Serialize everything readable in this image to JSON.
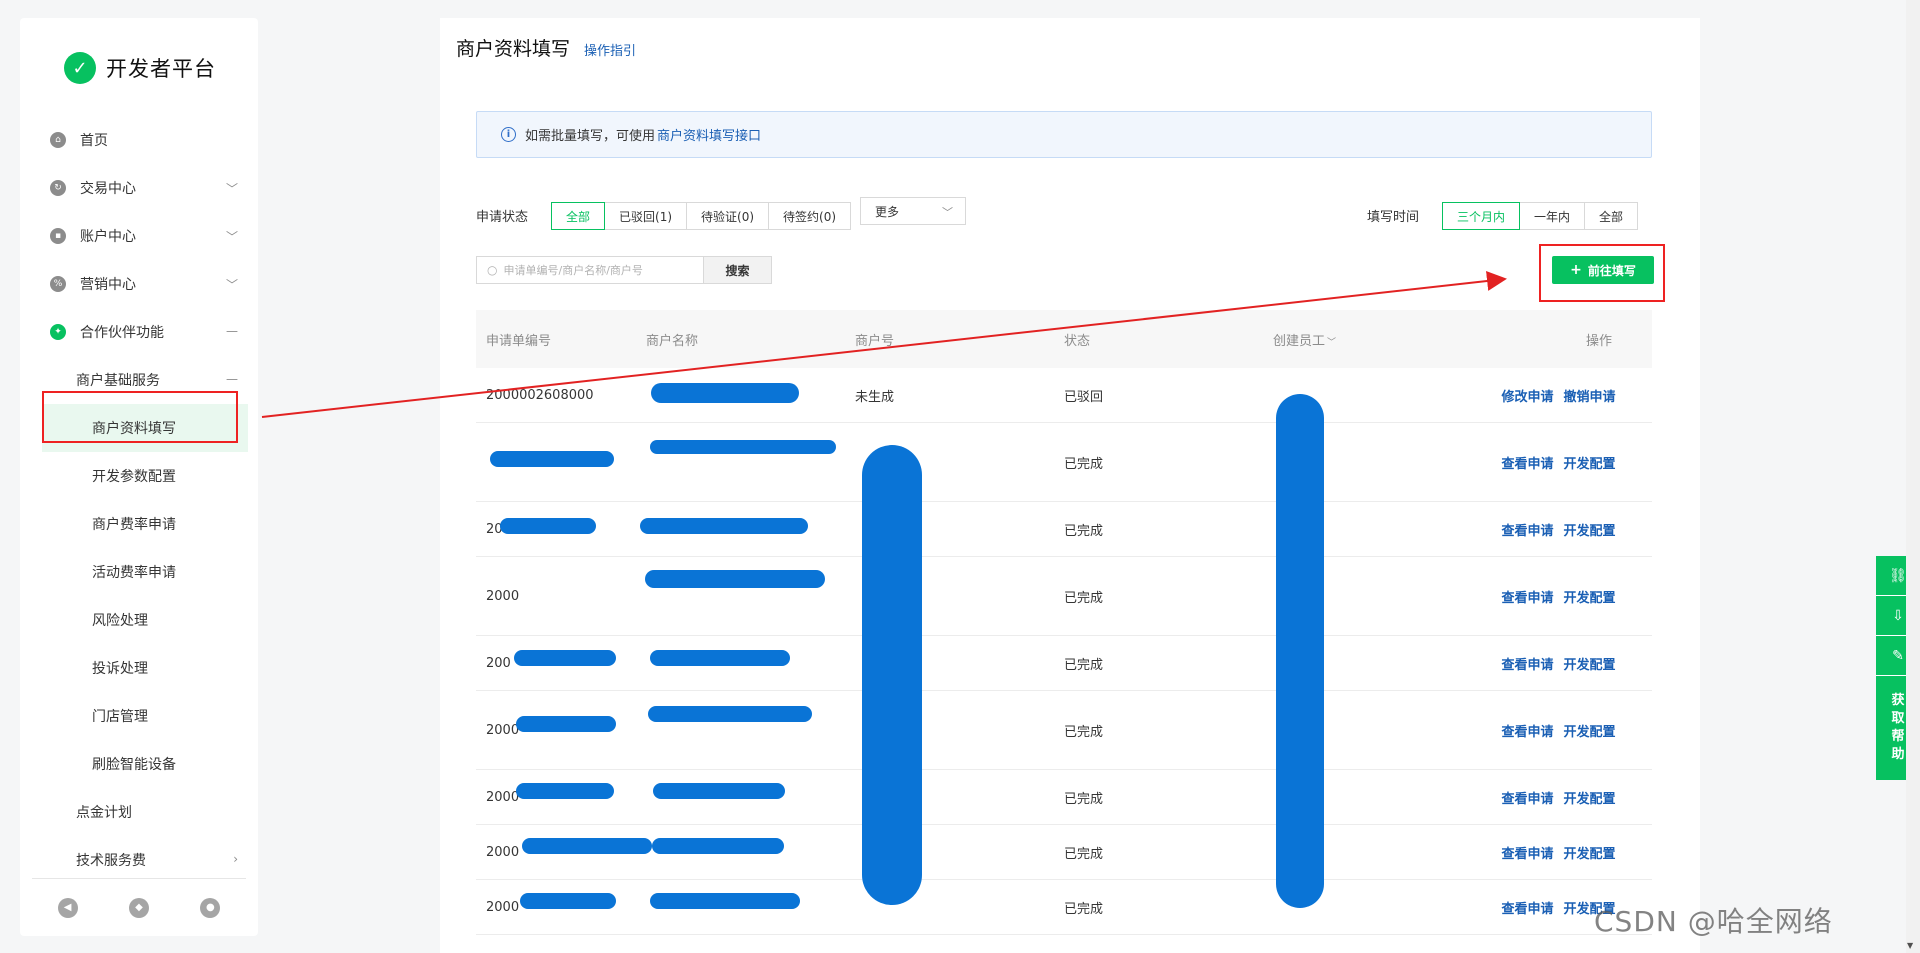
{
  "app": {
    "logo_text": "开发者平台"
  },
  "sidebar": {
    "items": [
      {
        "label": "首页"
      },
      {
        "label": "交易中心"
      },
      {
        "label": "账户中心"
      },
      {
        "label": "营销中心"
      },
      {
        "label": "合作伙伴功能"
      },
      {
        "label": "商户基础服务"
      },
      {
        "label": "商户资料填写"
      },
      {
        "label": "开发参数配置"
      },
      {
        "label": "商户费率申请"
      },
      {
        "label": "活动费率申请"
      },
      {
        "label": "风险处理"
      },
      {
        "label": "投诉处理"
      },
      {
        "label": "门店管理"
      },
      {
        "label": "刷脸智能设备"
      },
      {
        "label": "点金计划"
      },
      {
        "label": "技术服务费"
      }
    ]
  },
  "header": {
    "title": "商户资料填写",
    "guide_link": "操作指引"
  },
  "notice": {
    "text": "如需批量填写，可使用",
    "link": "商户资料填写接口"
  },
  "filters": {
    "status_label": "申请状态",
    "status_options": [
      "全部",
      "已驳回(1)",
      "待验证(0)",
      "待签约(0)"
    ],
    "more_label": "更多",
    "time_label": "填写时间",
    "time_options": [
      "三个月内",
      "一年内",
      "全部"
    ]
  },
  "search": {
    "placeholder": "申请单编号/商户名称/商户号",
    "button": "搜索"
  },
  "go_fill_button": "前往填写",
  "table": {
    "headers": [
      "申请单编号",
      "商户名称",
      "商户号",
      "状态",
      "创建员工",
      "操作"
    ],
    "rows": [
      {
        "id": "2000002608000",
        "merchant_no": "未生成",
        "status": "已驳回",
        "actions": [
          "修改申请",
          "撤销申请"
        ]
      },
      {
        "id": "",
        "merchant_no": "",
        "status": "已完成",
        "actions": [
          "查看申请",
          "开发配置"
        ]
      },
      {
        "id": "20",
        "merchant_no": "",
        "status": "已完成",
        "actions": [
          "查看申请",
          "开发配置"
        ]
      },
      {
        "id": "2000",
        "merchant_no": "",
        "status": "已完成",
        "actions": [
          "查看申请",
          "开发配置"
        ]
      },
      {
        "id": "200",
        "merchant_no": "",
        "status": "已完成",
        "actions": [
          "查看申请",
          "开发配置"
        ]
      },
      {
        "id": "2000",
        "merchant_no": "",
        "status": "已完成",
        "actions": [
          "查看申请",
          "开发配置"
        ]
      },
      {
        "id": "2000",
        "merchant_no": "",
        "status": "已完成",
        "actions": [
          "查看申请",
          "开发配置"
        ]
      },
      {
        "id": "2000",
        "merchant_no": "",
        "status": "已完成",
        "actions": [
          "查看申请",
          "开发配置"
        ]
      },
      {
        "id": "2000",
        "merchant_no": "",
        "status": "已完成",
        "actions": [
          "查看申请",
          "开发配置"
        ]
      }
    ]
  },
  "float_bar": {
    "help_label": "获取帮助"
  },
  "watermark": "CSDN @哈全网络",
  "colors": {
    "brand": "#07c160",
    "link": "#1a5fb4",
    "annotation": "#e22222",
    "redact": "#0a74d6"
  }
}
